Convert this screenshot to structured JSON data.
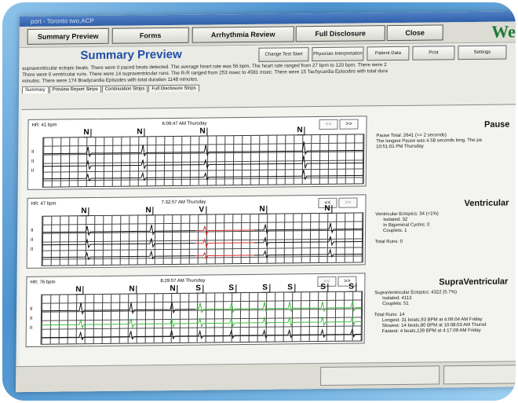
{
  "window": {
    "title": "port - Toronto two,ACP"
  },
  "topbar": {
    "buttons": [
      "Summary Preview",
      "Forms",
      "Arrhythmia Review",
      "Full Disclosure",
      "Close"
    ],
    "logo": "Welc"
  },
  "header": {
    "title": "Summary Preview",
    "buttons": [
      "Change Test Start",
      "Physician Interpretation",
      "Patient Data",
      "Print",
      "Settings"
    ]
  },
  "summary": {
    "lines": [
      "supraventricular ectopic beats. There were 0 paced beats detected. The average heart rate was 56 bpm. The heart rate ranged from 27 bpm to 120 bpm. There were 2",
      "There were 0 ventricular runs. There were 14 supraventricular runs. The R-R ranged from 253 msec to 4581 msec. There were 15 Tachycardia Episodes with total dura",
      "minutes. There were 174 Bradycardia Episodes with total duration 1148 minutes."
    ]
  },
  "tabs": [
    "Summary",
    "Preview Report Strips",
    "Continuation Strips",
    "Full Disclosure Strips"
  ],
  "strips": [
    {
      "hr": "HR: 41 bpm",
      "time": "6:09:47 AM Thursday",
      "prev": "<<",
      "next": ">>",
      "beats": [
        "N",
        "N",
        "N",
        "N"
      ],
      "leads": [
        "II",
        "II",
        "II"
      ],
      "info": {
        "heading": "Pause",
        "lines": [
          "Pause Total: 2641  (>= 2 seconds)",
          "The longest Pause was 4.58 seconds long. The pa",
          "10:51:01 PM Thursday"
        ]
      }
    },
    {
      "hr": "HR: 47 bpm",
      "time": "7:32:57 AM Thursday",
      "prev": "<<",
      "next": ">>",
      "beats": [
        "N",
        "N",
        "V",
        "N",
        "N"
      ],
      "leads": [
        "II",
        "II",
        "II"
      ],
      "info": {
        "heading": "Ventricular",
        "lines": [
          "Ventricular Ectopics: 34 (<1%)"
        ],
        "sub": [
          "Isolated: 32",
          "In Bigeminal Cycles: 0",
          "Couplets: 1"
        ],
        "extra": [
          "Total Runs: 0"
        ]
      }
    },
    {
      "hr": "HR: 76 bpm",
      "time": "8:29:57 AM Thursday",
      "prev": "<<",
      "next": ">>",
      "beats": [
        "N",
        "N",
        "N",
        "S",
        "S",
        "S",
        "S",
        "S",
        "S"
      ],
      "leads": [
        "II",
        "II",
        "II"
      ],
      "info": {
        "heading": "SupraVentricular",
        "lines": [
          "SupraVentricular Ectopics: 4322 (5.7%)"
        ],
        "sub": [
          "Isolated: 4113",
          "Couplets: 51"
        ],
        "extra": [
          "Total Runs: 14"
        ],
        "sub2": [
          "Longest: 31 beats,93 BPM at 4:06:04 AM Friday",
          "Slowest: 14 beats,80 BPM at 10:08:03 AM Thursd",
          "Fastest: 4 beats,139 BPM at 4:17:09 AM Friday"
        ]
      }
    }
  ],
  "colors": {
    "accent": "#1f4fa8",
    "logo": "#1d7a35",
    "trace": "#111111",
    "trace_red": "#d63030",
    "trace_green": "#3cbf3c",
    "frame": "#4d93cf"
  }
}
